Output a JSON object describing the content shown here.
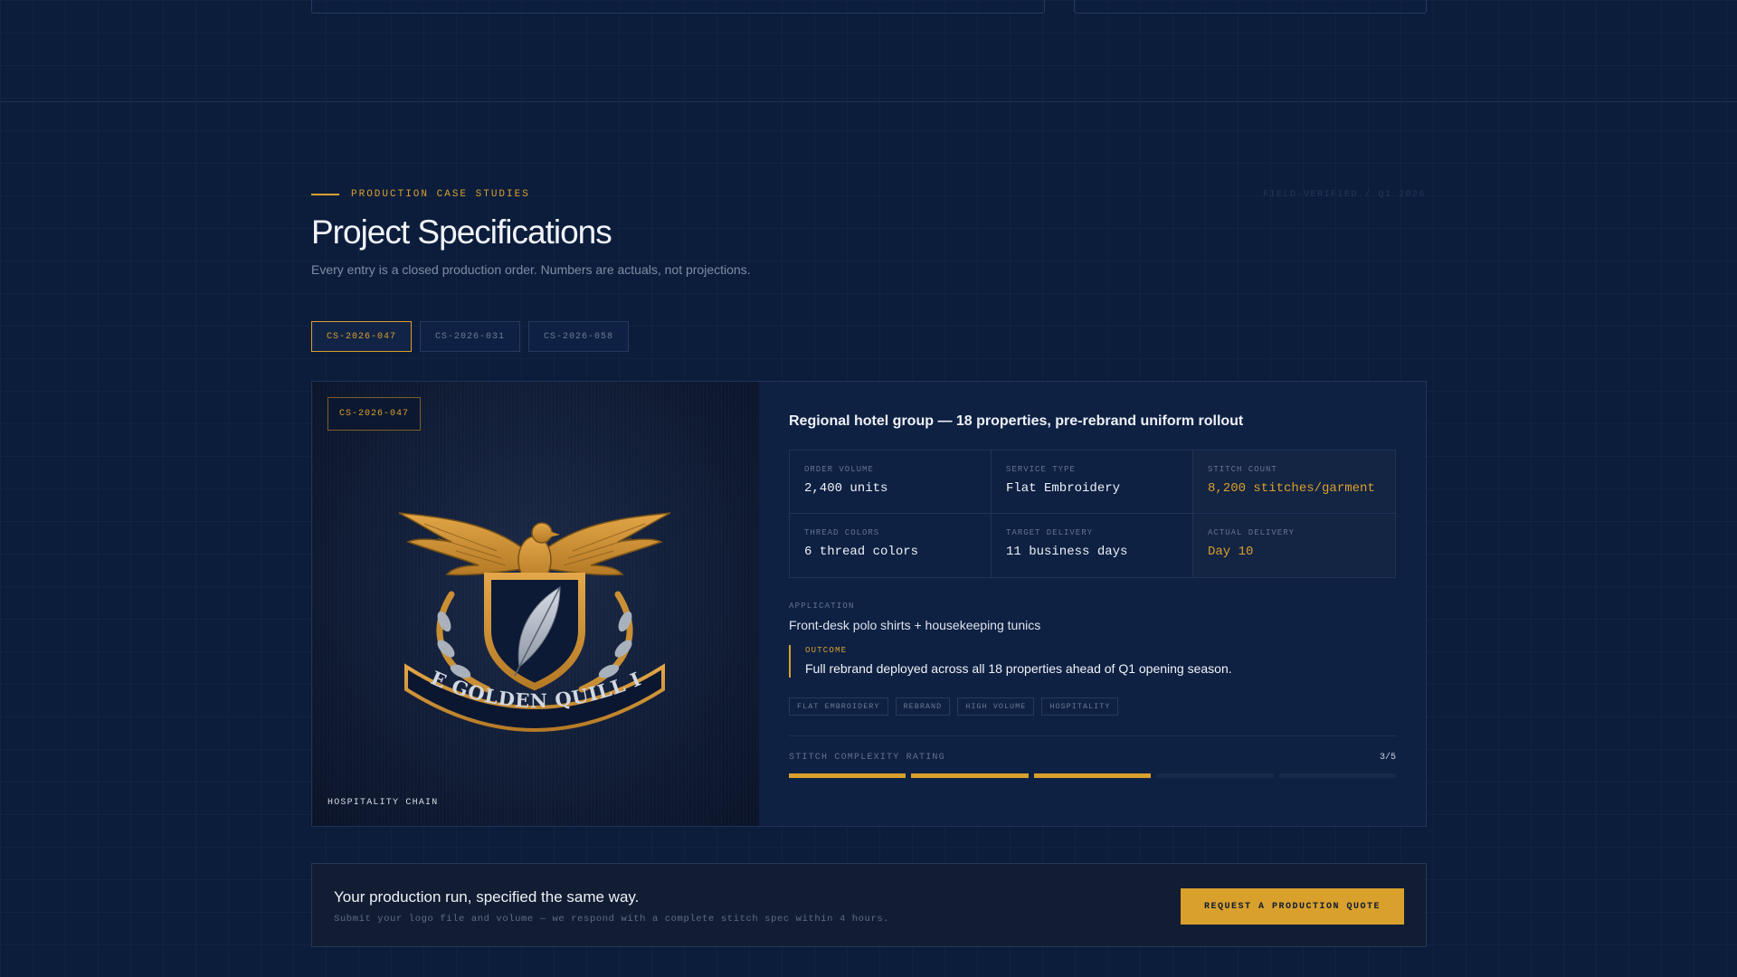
{
  "section": {
    "eyebrow": "PRODUCTION CASE STUDIES",
    "verified": "FIELD-VERIFIED / Q1 2026",
    "title": "Project Specifications",
    "subtitle": "Every entry is a closed production order. Numbers are actuals, not projections."
  },
  "tabs": [
    {
      "label": "CS-2026-047",
      "active": true
    },
    {
      "label": "CS-2026-031",
      "active": false
    },
    {
      "label": "CS-2026-058",
      "active": false
    }
  ],
  "case": {
    "badge": "CS-2026-047",
    "image_caption": "HOSPITALITY CHAIN",
    "crest_text": "THE GOLDEN QUILL INN",
    "heading": "Regional hotel group — 18 properties, pre-rebrand uniform rollout",
    "specs": [
      {
        "label": "ORDER VOLUME",
        "value": "2,400 units"
      },
      {
        "label": "SERVICE TYPE",
        "value": "Flat Embroidery"
      },
      {
        "label": "STITCH COUNT",
        "value": "8,200 stitches/garment"
      },
      {
        "label": "THREAD COLORS",
        "value": "6 thread colors"
      },
      {
        "label": "TARGET DELIVERY",
        "value": "11 business days"
      },
      {
        "label": "ACTUAL DELIVERY",
        "value": "Day 10"
      }
    ],
    "application_label": "APPLICATION",
    "application": "Front-desk polo shirts + housekeeping tunics",
    "outcome_label": "OUTCOME",
    "outcome": "Full rebrand deployed across all 18 properties ahead of Q1 opening season.",
    "tags": [
      "FLAT EMBROIDERY",
      "REBRAND",
      "HIGH VOLUME",
      "HOSPITALITY"
    ],
    "rating_label": "STITCH COMPLEXITY RATING",
    "rating_text": "3/5",
    "rating_value": 3,
    "rating_max": 5
  },
  "cta": {
    "title": "Your production run, specified the same way.",
    "subtitle": "Submit your logo file and volume — we respond with a complete stitch spec within 4 hours.",
    "button": "REQUEST A PRODUCTION QUOTE"
  },
  "colors": {
    "background": "#0c1d3c",
    "accent": "#d9a02c",
    "card": "#0e2143"
  }
}
